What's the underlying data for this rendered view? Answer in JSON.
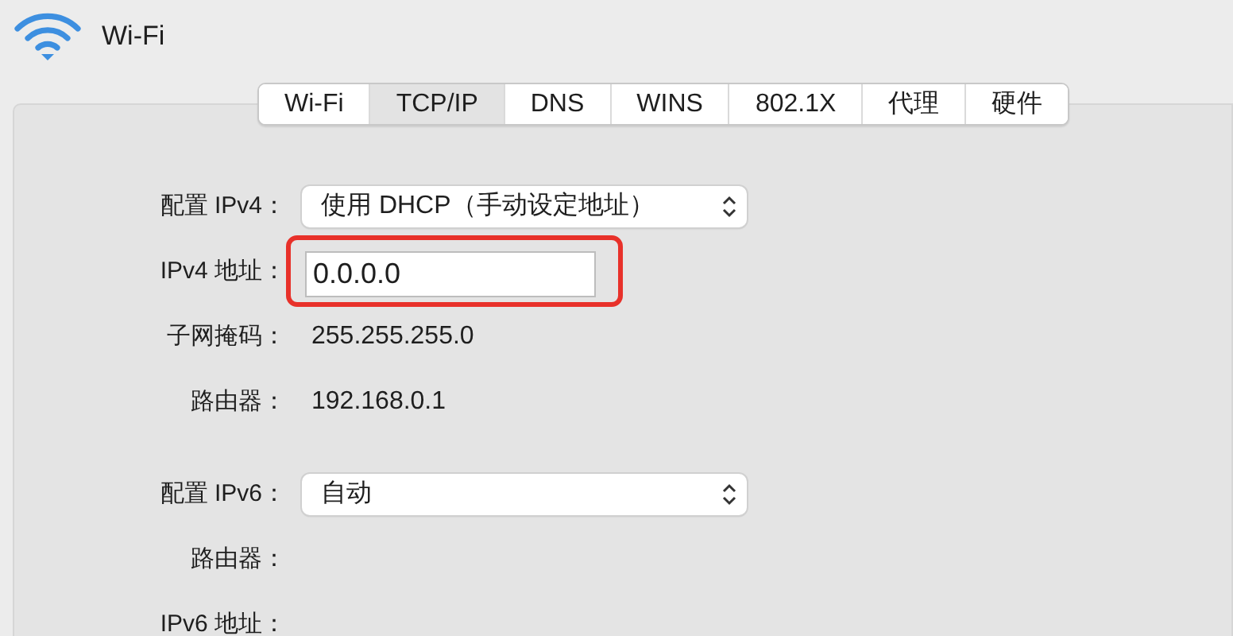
{
  "window": {
    "title": "Wi-Fi"
  },
  "tabs": [
    {
      "label": "Wi-Fi",
      "selected": false
    },
    {
      "label": "TCP/IP",
      "selected": true
    },
    {
      "label": "DNS",
      "selected": false
    },
    {
      "label": "WINS",
      "selected": false
    },
    {
      "label": "802.1X",
      "selected": false
    },
    {
      "label": "代理",
      "selected": false
    },
    {
      "label": "硬件",
      "selected": false
    }
  ],
  "sections": [
    {
      "rows": [
        {
          "kind": "popup",
          "label": "配置 IPv4：",
          "value": "使用 DHCP（手动设定地址）"
        },
        {
          "kind": "field",
          "label": "IPv4 地址：",
          "value": "0.0.0.0",
          "highlighted": true
        },
        {
          "kind": "text",
          "label": "子网掩码：",
          "value": "255.255.255.0"
        },
        {
          "kind": "text",
          "label": "路由器：",
          "value": "192.168.0.1"
        }
      ]
    },
    {
      "rows": [
        {
          "kind": "popup",
          "label": "配置 IPv6：",
          "value": "自动"
        },
        {
          "kind": "text",
          "label": "路由器："
        },
        {
          "kind": "text",
          "label": "IPv6 地址："
        }
      ]
    }
  ]
}
